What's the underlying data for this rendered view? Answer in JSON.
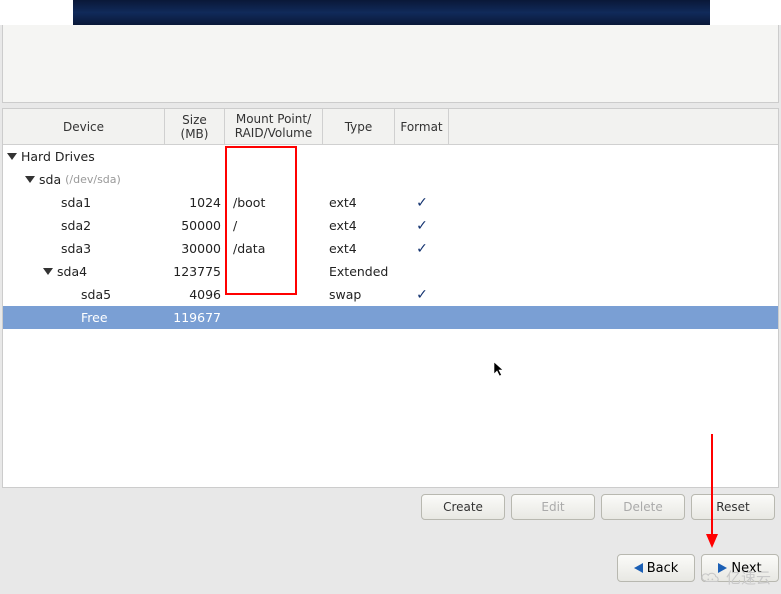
{
  "header": {
    "columns": {
      "device": "Device",
      "size_line1": "Size",
      "size_line2": "(MB)",
      "mount_line1": "Mount Point/",
      "mount_line2": "RAID/Volume",
      "type": "Type",
      "format": "Format"
    }
  },
  "tree": {
    "root_label": "Hard Drives",
    "disk": {
      "name": "sda",
      "path": "(/dev/sda)"
    },
    "rows": [
      {
        "device": "sda1",
        "size": "1024",
        "mount": "/boot",
        "type": "ext4",
        "format": true,
        "indent": "indent2"
      },
      {
        "device": "sda2",
        "size": "50000",
        "mount": "/",
        "type": "ext4",
        "format": true,
        "indent": "indent2"
      },
      {
        "device": "sda3",
        "size": "30000",
        "mount": "/data",
        "type": "ext4",
        "format": true,
        "indent": "indent2"
      },
      {
        "device": "sda4",
        "size": "123775",
        "mount": "",
        "type": "Extended",
        "format": false,
        "indent": "indent2b",
        "expander": true
      },
      {
        "device": "sda5",
        "size": "4096",
        "mount": "",
        "type": "swap",
        "format": true,
        "indent": "indent3"
      },
      {
        "device": "Free",
        "size": "119677",
        "mount": "",
        "type": "",
        "format": false,
        "indent": "indent3",
        "selected": true
      }
    ]
  },
  "buttons": {
    "create": "Create",
    "edit": "Edit",
    "delete": "Delete",
    "reset": "Reset",
    "back": "Back",
    "next": "Next"
  },
  "watermark": {
    "text": "亿速云"
  },
  "check_glyph": "✓"
}
